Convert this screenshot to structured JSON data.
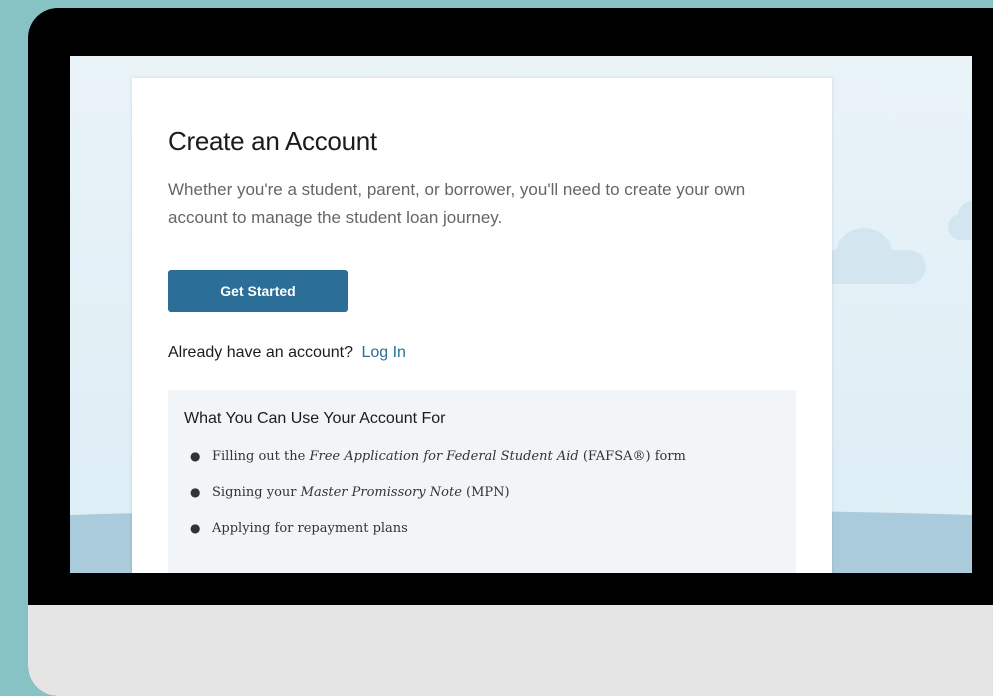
{
  "card": {
    "title": "Create an Account",
    "description": "Whether you're a student, parent, or borrower, you'll need to create your own account to manage the student loan journey.",
    "get_started_label": "Get Started",
    "login_prompt": "Already have an account?",
    "login_link": "Log In"
  },
  "info": {
    "heading": "What You Can Use Your Account For",
    "items": [
      {
        "prefix": "Filling out the ",
        "emphasis": "Free Application for Federal Student Aid",
        "suffix": " (FAFSA®) form"
      },
      {
        "prefix": "Signing your ",
        "emphasis": "Master Promissory Note",
        "suffix": " (MPN)"
      },
      {
        "prefix": "Applying for repayment plans",
        "emphasis": "",
        "suffix": ""
      }
    ]
  },
  "colors": {
    "outer_background": "#87c3c5",
    "button": "#2b6e98",
    "link": "#2b6e98",
    "info_panel": "#f1f5f8"
  }
}
